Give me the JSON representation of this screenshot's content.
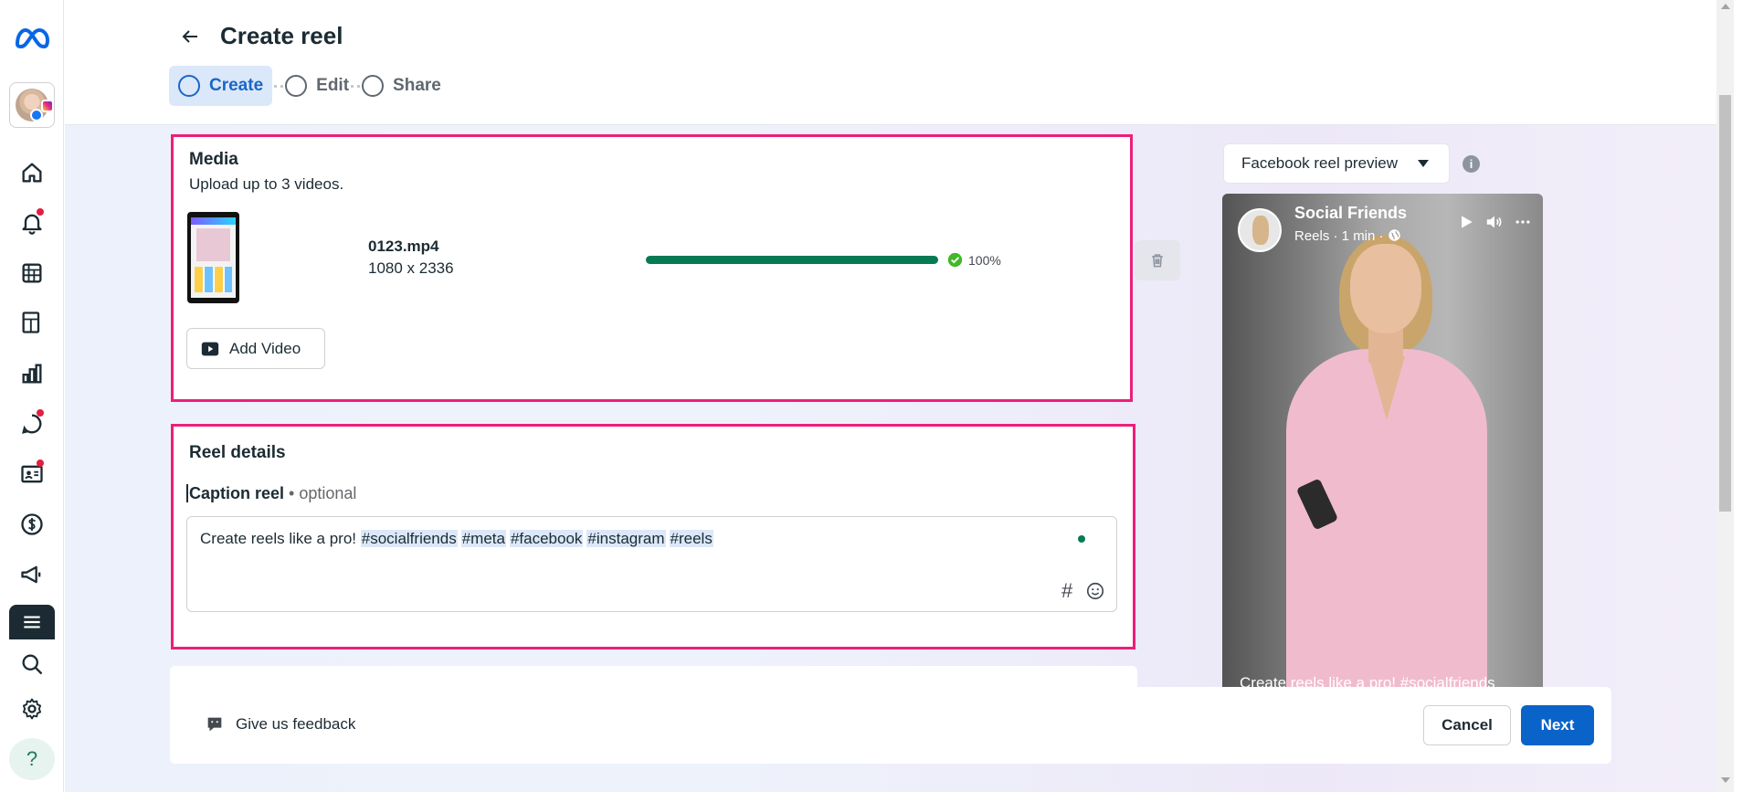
{
  "header": {
    "title": "Create reel",
    "steps": [
      {
        "label": "Create",
        "active": true
      },
      {
        "label": "Edit",
        "active": false
      },
      {
        "label": "Share",
        "active": false
      }
    ]
  },
  "sidebar": {
    "items": [
      {
        "icon": "meta-logo-icon"
      },
      {
        "icon": "account-avatar"
      },
      {
        "icon": "home-icon"
      },
      {
        "icon": "notifications-icon",
        "badge": true
      },
      {
        "icon": "table-icon"
      },
      {
        "icon": "posts-icon"
      },
      {
        "icon": "insights-icon"
      },
      {
        "icon": "inbox-icon",
        "badge": true
      },
      {
        "icon": "contacts-icon",
        "badge": true
      },
      {
        "icon": "monetization-icon"
      },
      {
        "icon": "ads-icon"
      },
      {
        "icon": "menu-icon"
      },
      {
        "icon": "search-icon"
      },
      {
        "icon": "settings-icon"
      },
      {
        "icon": "help-icon",
        "label": "?"
      }
    ]
  },
  "media": {
    "title": "Media",
    "subtitle": "Upload up to 3 videos.",
    "file": {
      "name": "0123.mp4",
      "dimensions": "1080 x 2336",
      "progress": 100,
      "progress_label": "100%"
    },
    "add_video_label": "Add Video"
  },
  "details": {
    "title": "Reel details",
    "caption_label": "Caption reel",
    "caption_optional": "• optional",
    "caption_text": "Create reels like a pro!",
    "hashtags": [
      "#socialfriends",
      "#meta",
      "#facebook",
      "#instagram",
      "#reels"
    ],
    "hash_symbol": "#"
  },
  "preview": {
    "selector_label": "Facebook reel preview",
    "info_label": "i",
    "account_name": "Social Friends",
    "meta": "Reels · 1 min ·",
    "caption": "Create reels like a pro! #socialfriends"
  },
  "footer": {
    "feedback_label": "Give us feedback",
    "cancel_label": "Cancel",
    "next_label": "Next"
  },
  "colors": {
    "accent": "#0a63c9",
    "highlight_border": "#ee1e7a",
    "progress": "#057a55"
  }
}
